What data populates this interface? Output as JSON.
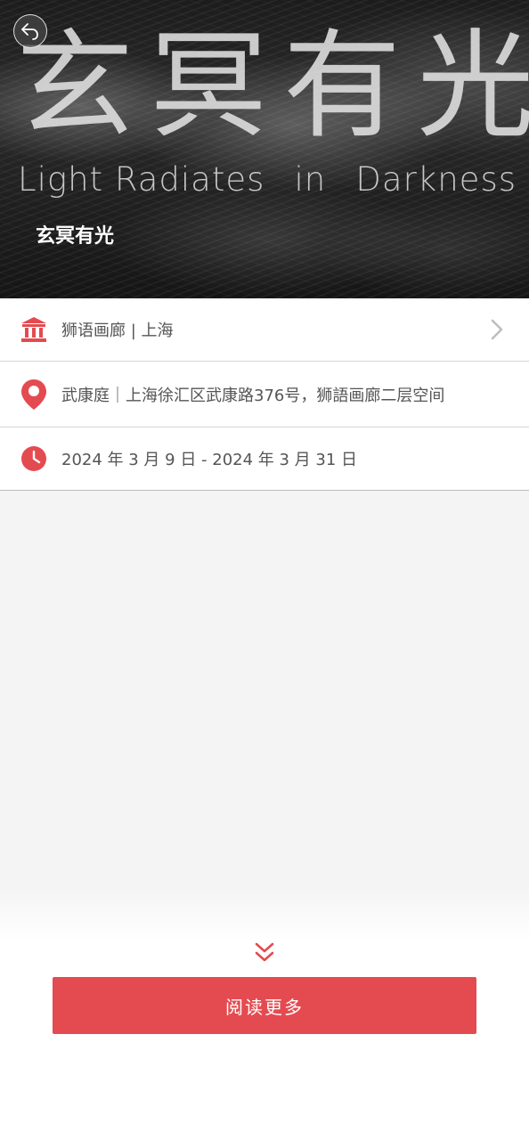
{
  "hero": {
    "big_title": "玄冥有光",
    "sub_title_words": [
      "Light Radiates",
      "in",
      "Darkness"
    ],
    "label": "玄冥有光",
    "back_icon": "back-arrow-icon"
  },
  "info": {
    "venue": {
      "icon": "museum-icon",
      "text": "狮语画廊 | 上海",
      "chevron_icon": "chevron-right-icon"
    },
    "address": {
      "icon": "location-pin-icon",
      "text": "武康庭｜上海徐汇区武康路376号，狮語画廊二层空间"
    },
    "dates": {
      "icon": "clock-icon",
      "text": "2024 年 3 月 9 日 - 2024 年 3 月 31 日"
    }
  },
  "footer": {
    "expand_icon": "double-chevron-down-icon",
    "read_more_label": "阅读更多"
  },
  "colors": {
    "accent": "#e44b50",
    "text": "#555555",
    "background": "#f4f4f4"
  }
}
